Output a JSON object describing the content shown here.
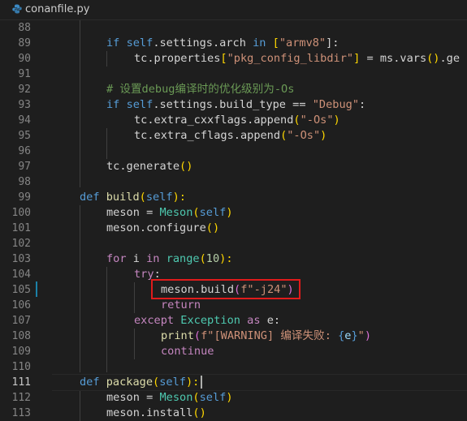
{
  "tab": {
    "filename": "conanfile.py",
    "icon": "python-file-icon"
  },
  "editor": {
    "active_line": 111,
    "highlighted_line": 105,
    "line_numbers": [
      "88",
      "89",
      "90",
      "91",
      "92",
      "93",
      "94",
      "95",
      "96",
      "97",
      "98",
      "99",
      "100",
      "101",
      "102",
      "103",
      "104",
      "105",
      "106",
      "107",
      "108",
      "109",
      "110",
      "111",
      "112",
      "113"
    ],
    "code": {
      "l89": [
        "if ",
        "self",
        ".settings.arch ",
        "in ",
        "[",
        "\"armv8\"",
        "]:"
      ],
      "l90": [
        "tc.properties",
        "[",
        "\"pkg_config_libdir\"",
        "]",
        " = ms.vars",
        "()",
        ".ge"
      ],
      "l92": "# 设置debug编译时的优化级别为-Os",
      "l93": [
        "if ",
        "self",
        ".settings.build_type == ",
        "\"Debug\"",
        ":"
      ],
      "l94": [
        "tc.extra_cxxflags.append",
        "(",
        "\"-Os\"",
        ")"
      ],
      "l95": [
        "tc.extra_cflags.append",
        "(",
        "\"-Os\"",
        ")"
      ],
      "l97": [
        "tc.generate",
        "()"
      ],
      "l99": [
        "def ",
        "build",
        "(",
        "self",
        "):"
      ],
      "l100": [
        "meson = ",
        "Meson",
        "(",
        "self",
        ")"
      ],
      "l101": [
        "meson.configure",
        "()"
      ],
      "l103": [
        "for ",
        "i ",
        "in ",
        "range",
        "(",
        "10",
        "):"
      ],
      "l104": [
        "try",
        ":"
      ],
      "l105": [
        "meson.build",
        "(",
        "f\"-j24\"",
        ")"
      ],
      "l106": "return",
      "l107": [
        "except ",
        "Exception ",
        "as ",
        "e:"
      ],
      "l108": [
        "print",
        "(",
        "f\"[WARNING] 编译失败: ",
        "{",
        "e",
        "}",
        "\"",
        ")"
      ],
      "l109": "continue",
      "l111": [
        "def ",
        "package",
        "(",
        "self",
        "):"
      ],
      "l112": [
        "meson = ",
        "Meson",
        "(",
        "self",
        ")"
      ],
      "l113": [
        "meson.install",
        "()"
      ]
    }
  },
  "colors": {
    "background": "#1e1e1e",
    "keyword": "#569cd6",
    "control": "#c586c0",
    "function": "#dcdcaa",
    "class": "#4ec9b0",
    "string": "#ce9178",
    "number": "#b5cea8",
    "comment": "#6a9955",
    "highlight_box": "#e01b1b"
  }
}
